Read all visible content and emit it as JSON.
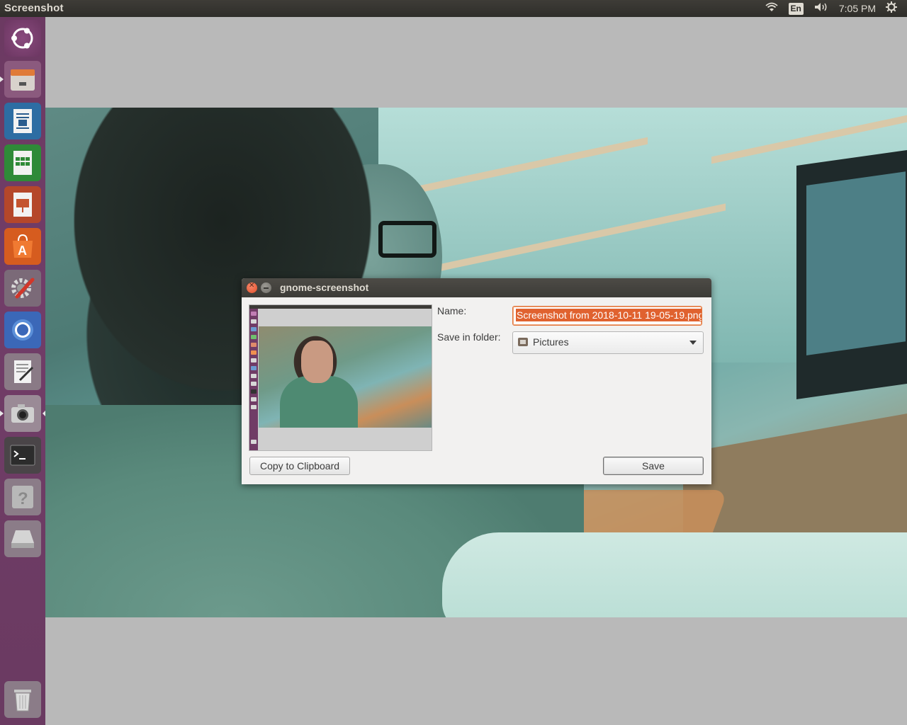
{
  "top_panel": {
    "title": "Screenshot",
    "keyboard_layout": "En",
    "clock": "7:05 PM",
    "icons": [
      "wifi-icon",
      "keyboard-layout-icon",
      "volume-icon",
      "settings-gear-icon"
    ]
  },
  "launcher": {
    "items": [
      {
        "name": "ubuntu-dash",
        "icon": "ubuntu-logo-icon"
      },
      {
        "name": "files",
        "icon": "file-cabinet-icon"
      },
      {
        "name": "libreoffice-writer",
        "icon": "writer-document-icon"
      },
      {
        "name": "libreoffice-calc",
        "icon": "calc-spreadsheet-icon"
      },
      {
        "name": "libreoffice-impress",
        "icon": "impress-presentation-icon"
      },
      {
        "name": "ubuntu-software",
        "icon": "software-bag-icon"
      },
      {
        "name": "system-settings",
        "icon": "settings-wrench-icon"
      },
      {
        "name": "chromium",
        "icon": "chromium-browser-icon"
      },
      {
        "name": "text-editor",
        "icon": "text-editor-icon"
      },
      {
        "name": "screenshot",
        "icon": "camera-icon"
      },
      {
        "name": "terminal",
        "icon": "terminal-icon"
      },
      {
        "name": "help",
        "icon": "help-question-icon"
      },
      {
        "name": "disk",
        "icon": "disk-drive-icon"
      },
      {
        "name": "trash",
        "icon": "trash-icon"
      }
    ]
  },
  "dialog": {
    "title": "gnome-screenshot",
    "name_label": "Name:",
    "name_value": "Screenshot from 2018-10-11 19-05-19.png",
    "folder_label": "Save in folder:",
    "folder_value": "Pictures",
    "copy_button": "Copy to Clipboard",
    "save_button": "Save"
  },
  "colors": {
    "accent": "#e0622f",
    "launcher": "#6c3a62",
    "panel": "#3c3b37"
  }
}
